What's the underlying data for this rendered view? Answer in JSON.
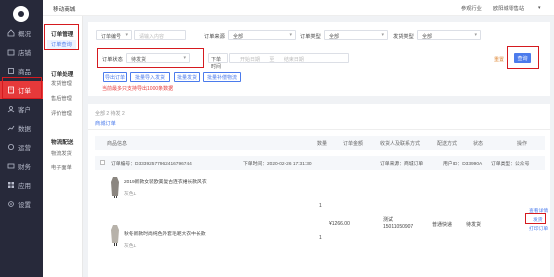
{
  "header": {
    "app_name": "移动商城",
    "shop": "参观行业",
    "user": "欧阳城零售站",
    "user_caret": "▾"
  },
  "sidebar": {
    "items": [
      {
        "label": "概况",
        "icon": "home-icon"
      },
      {
        "label": "店铺",
        "icon": "store-icon"
      },
      {
        "label": "商品",
        "icon": "goods-icon"
      },
      {
        "label": "订单",
        "icon": "order-icon"
      },
      {
        "label": "客户",
        "icon": "customer-icon"
      },
      {
        "label": "数据",
        "icon": "chart-icon"
      },
      {
        "label": "运营",
        "icon": "ops-icon"
      },
      {
        "label": "财务",
        "icon": "finance-icon"
      },
      {
        "label": "应用",
        "icon": "app-icon"
      },
      {
        "label": "设置",
        "icon": "gear-icon"
      }
    ]
  },
  "subnav": {
    "group1": "订单管理",
    "item_selected": "订单查询",
    "group2": "订单处理",
    "g2_items": [
      "发货管理",
      "售后管理",
      "评价管理"
    ],
    "group3": "物流配送",
    "g3_items": [
      "物流发货",
      "电子面单"
    ]
  },
  "filters": {
    "order_no_select": "订单编号",
    "order_no_placeholder": "请输入内容",
    "source_label": "订单来源",
    "source_value": "全部",
    "type_label": "订单类型",
    "type_value": "全部",
    "ship_label": "发货类型",
    "ship_value": "全部",
    "status_label": "订单状态",
    "status_value": "待发货",
    "time_select": "下单时间",
    "start_placeholder": "开始日期",
    "range_sep": "至",
    "end_placeholder": "结束日期",
    "reset": "重置",
    "query": "查询"
  },
  "actions": {
    "export": "导出订单",
    "bulk_import": "批量导入发货",
    "bulk_ship": "批量发货",
    "bulk_cancel": "批量补偿物流",
    "note": "当前最多只支持导出1000条数据"
  },
  "tabs": {
    "counts": "全部 2   待发 2",
    "label": "商城订单"
  },
  "table_headers": [
    "商品信息",
    "数量",
    "订单金额",
    "收货人及联系方式",
    "配送方式",
    "状态",
    "操作"
  ],
  "order": {
    "order_no": "订单编号：D33392577962416796744",
    "order_time": "下单时间：2020-02-26 17:31:30",
    "channel": "订单来源：商城订单",
    "user_id": "用户ID：D33990A",
    "order_type": "订单类型：公众号",
    "products": [
      {
        "name": "2019新款女装欧美复古连衣裙长款风衣",
        "spec": "灰色L",
        "qty": "1"
      },
      {
        "name": "秋冬新款时尚纯色外套毛呢大衣中长款",
        "spec": "灰色L",
        "qty": "1"
      }
    ],
    "amount": "¥1266.00",
    "receiver_name": "测试",
    "receiver_phone": "15011050907",
    "delivery": "普通快递",
    "status": "待发货",
    "ops": [
      "查看详情",
      "发货",
      "打印订单"
    ]
  }
}
